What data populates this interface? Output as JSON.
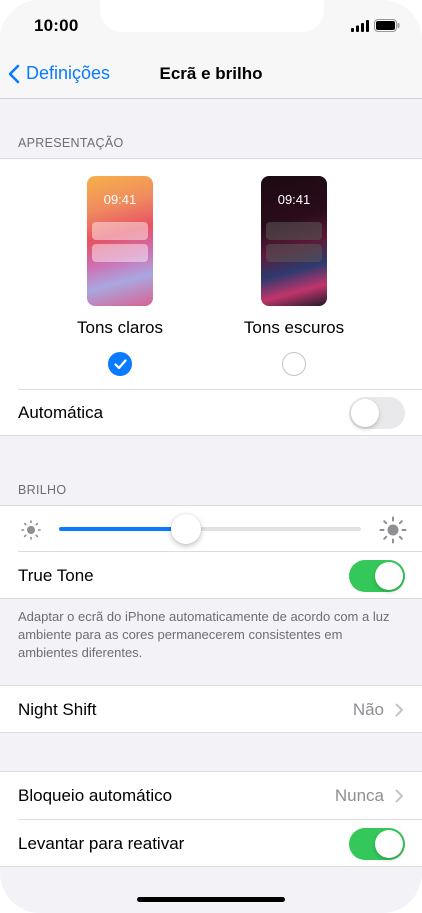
{
  "status": {
    "time": "10:00"
  },
  "nav": {
    "back_label": "Definições",
    "title": "Ecrã e brilho"
  },
  "appearance": {
    "header": "APRESENTAÇÃO",
    "light": {
      "preview_time": "09:41",
      "label": "Tons claros",
      "selected": true
    },
    "dark": {
      "preview_time": "09:41",
      "label": "Tons escuros",
      "selected": false
    },
    "automatic": {
      "label": "Automática",
      "on": false
    }
  },
  "brightness": {
    "header": "BRILHO",
    "level": 0.42,
    "true_tone": {
      "label": "True Tone",
      "on": true
    },
    "footnote": "Adaptar o ecrã do iPhone automaticamente de acordo com a luz ambiente para as cores permanecerem consistentes em ambientes diferentes."
  },
  "night_shift": {
    "label": "Night Shift",
    "value": "Não"
  },
  "auto_lock": {
    "label": "Bloqueio automático",
    "value": "Nunca"
  },
  "raise_to_wake": {
    "label": "Levantar para reativar",
    "on": true
  },
  "colors": {
    "accent": "#0a7aff",
    "toggle_on": "#34c759",
    "background": "#f2f2f7"
  }
}
